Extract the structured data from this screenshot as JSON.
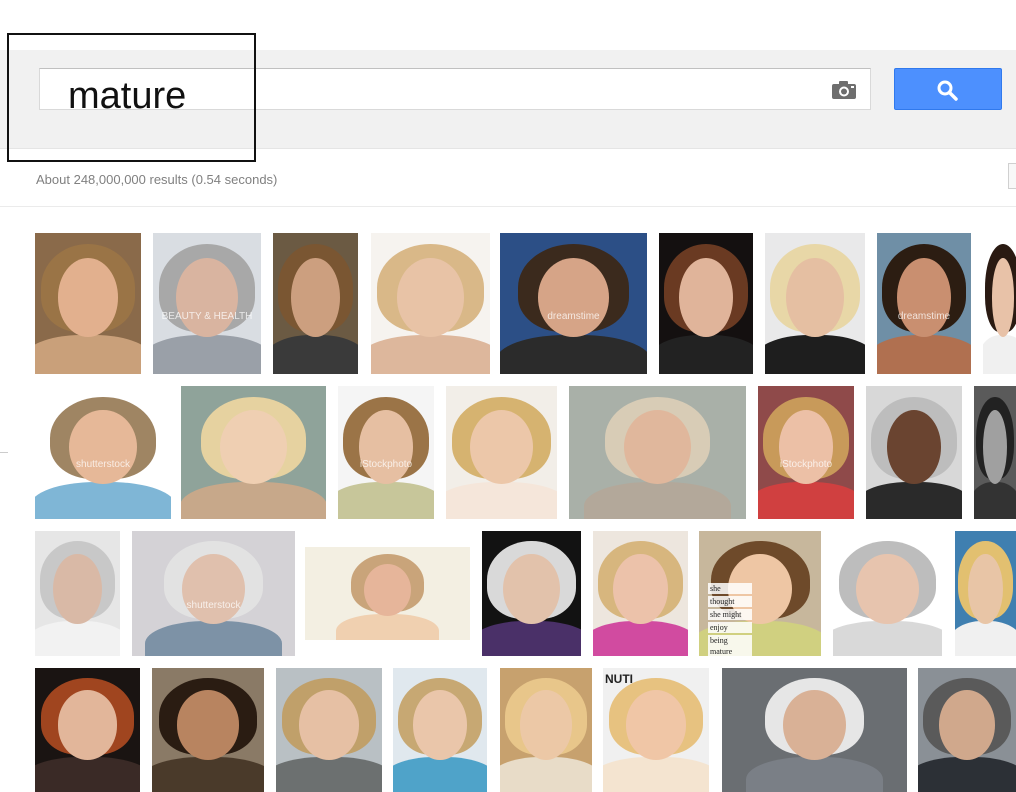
{
  "search": {
    "query": "mature",
    "camera_icon": "camera-icon",
    "search_icon": "magnifier-icon"
  },
  "results": {
    "stats": "About 248,000,000 results (0.54 seconds)"
  },
  "image_grid": {
    "rows": [
      {
        "items": [
          {
            "bg": "#8a6a4a",
            "skin": "#e2b08e",
            "hair": "#9a7446",
            "cloth": "#c9a07a"
          },
          {
            "bg": "#d9dde2",
            "skin": "#d9b4a0",
            "hair": "#a8a8a8",
            "cloth": "#9aa0a8",
            "watermark": "BEAUTY & HEALTH"
          },
          {
            "bg": "#6b5a43",
            "skin": "#cc9f7f",
            "hair": "#7a5632",
            "cloth": "#3a3a3a"
          },
          {
            "bg": "#f6f3ef",
            "skin": "#e8c3a6",
            "hair": "#d9b888",
            "cloth": "#ddb79c"
          },
          {
            "bg": "#2c4f86",
            "skin": "#d6a487",
            "hair": "#3b2a1d",
            "cloth": "#2b2b2b",
            "watermark": "dreamstime"
          },
          {
            "bg": "#141010",
            "skin": "#e0b49a",
            "hair": "#6a3a22",
            "cloth": "#222"
          },
          {
            "bg": "#e9e9ea",
            "skin": "#e5bfa2",
            "hair": "#e8d7a7",
            "cloth": "#1e1e1e"
          },
          {
            "bg": "#6f8fa6",
            "skin": "#c98f70",
            "hair": "#2c1d12",
            "cloth": "#b07050",
            "watermark": "dreamstime"
          },
          {
            "bg": "#ffffff",
            "skin": "#e8c2a8",
            "hair": "#2a1a12",
            "cloth": "#f0f0f0"
          }
        ]
      },
      {
        "items": [
          {
            "bg": "#ffffff",
            "skin": "#e6b898",
            "hair": "#9f8563",
            "cloth": "#7fb6d6",
            "watermark": "shutterstock"
          },
          {
            "bg": "#8fa39a",
            "skin": "#efcfb2",
            "hair": "#e6d2a0",
            "cloth": "#c7a88a"
          },
          {
            "bg": "#f5f5f5",
            "skin": "#e6bfa2",
            "hair": "#9b7447",
            "cloth": "#c7c69a",
            "watermark": "iStockphoto"
          },
          {
            "bg": "#f2eee8",
            "skin": "#ecc7a9",
            "hair": "#d6b370",
            "cloth": "#f5e6da"
          },
          {
            "bg": "#a9b0a8",
            "skin": "#e0b79c",
            "hair": "#d8ccb6",
            "cloth": "#b3a89a"
          },
          {
            "bg": "#8f4a4a",
            "skin": "#ecc0a6",
            "hair": "#c89a5a",
            "cloth": "#d04040",
            "watermark": "iStockphoto"
          },
          {
            "bg": "#d8d8d8",
            "skin": "#6a4430",
            "hair": "#bdbdbd",
            "cloth": "#2a2a2a"
          },
          {
            "bg": "#5a5a5a",
            "skin": "#a0a0a0",
            "hair": "#222",
            "cloth": "#333"
          }
        ]
      },
      {
        "items": [
          {
            "bg": "#e6e6e6",
            "skin": "#d9b9a6",
            "hair": "#c8c8c8",
            "cloth": "#f2f2f2"
          },
          {
            "bg": "#d4d2d6",
            "skin": "#e0c0ad",
            "hair": "#e2e2e2",
            "cloth": "#7d92a6",
            "watermark": "shutterstock"
          },
          {
            "bg": "#f3efe2",
            "skin": "#e6b59a",
            "hair": "#c9a47a",
            "cloth": "#f0d0b0"
          },
          {
            "bg": "#121212",
            "skin": "#e2c2ab",
            "hair": "#d9d9d9",
            "cloth": "#4a3068"
          },
          {
            "bg": "#ede6de",
            "skin": "#ecc2aa",
            "hair": "#d7b67e",
            "cloth": "#d14ba0"
          },
          {
            "bg": "#c7b79c",
            "skin": "#eec6a4",
            "hair": "#6e4a2a",
            "cloth": "#d0d080",
            "caption": [
              "she",
              "thought",
              "she might",
              "enjoy",
              "being mature"
            ]
          },
          {
            "bg": "#ffffff",
            "skin": "#e7c4ae",
            "hair": "#bdbdbd",
            "cloth": "#d9d9d9"
          },
          {
            "bg": "#3f7fb0",
            "skin": "#e8c5a6",
            "hair": "#e2c070",
            "cloth": "#f0f0f0"
          }
        ]
      },
      {
        "items": [
          {
            "bg": "#1a1412",
            "skin": "#e2b69a",
            "hair": "#a0451f",
            "cloth": "#3a2a26"
          },
          {
            "bg": "#8a7a66",
            "skin": "#b88460",
            "hair": "#2a1c12",
            "cloth": "#4a3a2a"
          },
          {
            "bg": "#b9c0c4",
            "skin": "#e6c0a4",
            "hair": "#c0a06a",
            "cloth": "#6c7070"
          },
          {
            "bg": "#e0e8ee",
            "skin": "#eac6aa",
            "hair": "#c7a873",
            "cloth": "#4fa3c9"
          },
          {
            "bg": "#c7a16e",
            "skin": "#ecc8a6",
            "hair": "#e8c68a",
            "cloth": "#e8dcc8"
          },
          {
            "bg": "#f0f0f0",
            "skin": "#f0c6a6",
            "hair": "#e7c280",
            "cloth": "#f4e4d0",
            "caption_text": "NUTI"
          },
          {
            "bg": "#6a6e72",
            "skin": "#d9b196",
            "hair": "#e6e6e6",
            "cloth": "#7a7f86"
          },
          {
            "bg": "#8a9096",
            "skin": "#d0a88c",
            "hair": "#5a5a5a",
            "cloth": "#2c3036"
          }
        ]
      }
    ]
  }
}
